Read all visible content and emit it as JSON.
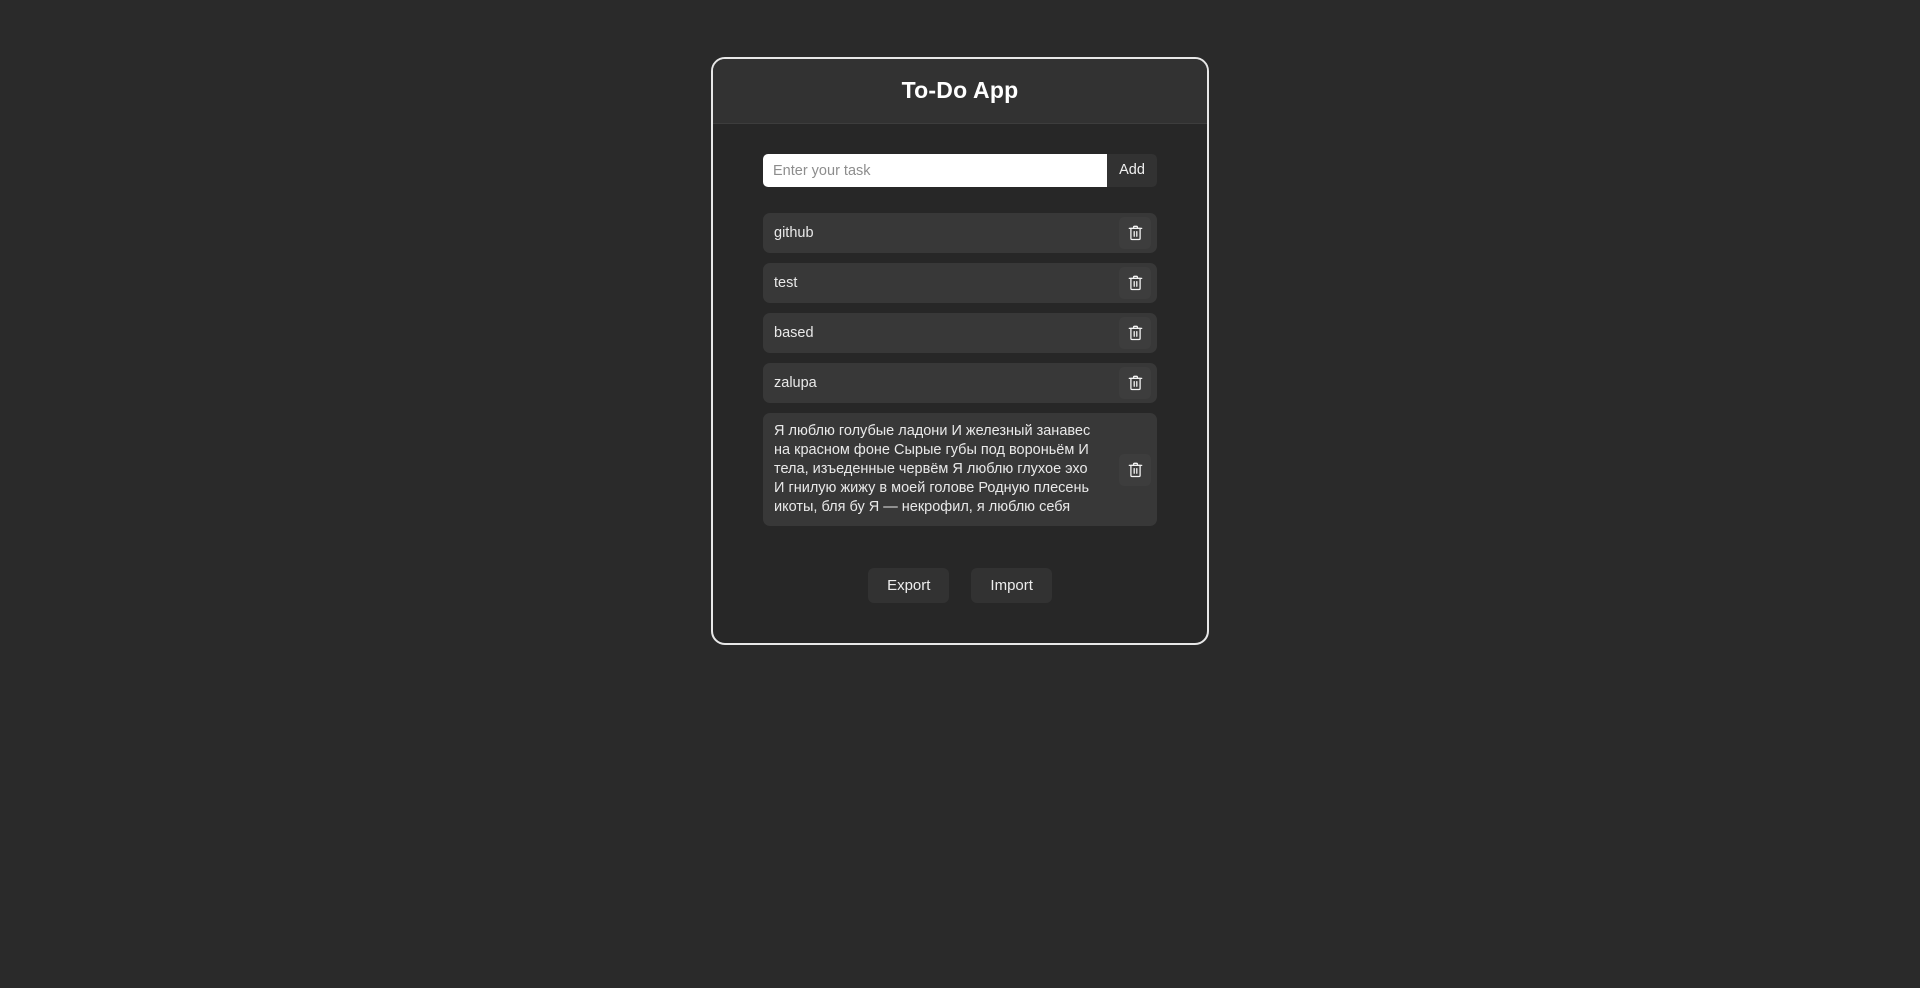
{
  "app": {
    "title": "To-Do App",
    "background_color": "#2a2a2a",
    "card_background": "#272727",
    "card_header_background": "#323232",
    "card_border_color": "#e8e8e8",
    "item_background": "#383838"
  },
  "add_form": {
    "placeholder": "Enter your task",
    "value": "",
    "add_label": "Add"
  },
  "tasks": [
    {
      "text": "github",
      "delete_icon": "trash-icon"
    },
    {
      "text": "test",
      "delete_icon": "trash-icon"
    },
    {
      "text": "based",
      "delete_icon": "trash-icon"
    },
    {
      "text": "zalupa",
      "delete_icon": "trash-icon"
    },
    {
      "text": "Я люблю голубые ладони И железный занавес на красном фоне Сырые губы под вороньём И тела, изъеденные червём Я люблю глухое эхо И гнилую жижу в моей голове Родную плесень икоты, бля бу Я — некрофил, я люблю себя",
      "delete_icon": "trash-icon"
    }
  ],
  "footer": {
    "export_label": "Export",
    "import_label": "Import"
  }
}
